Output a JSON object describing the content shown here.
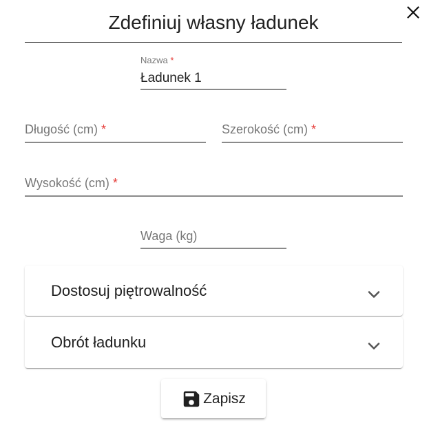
{
  "dialog": {
    "title": "Zdefiniuj własny ładunek",
    "close_icon": "close-icon"
  },
  "form": {
    "name": {
      "label": "Nazwa",
      "required_mark": "*",
      "value": "Ładunek 1"
    },
    "length": {
      "label": "Długość (cm)",
      "required_mark": "*",
      "value": ""
    },
    "width": {
      "label": "Szerokość (cm)",
      "required_mark": "*",
      "value": ""
    },
    "height": {
      "label": "Wysokość (cm)",
      "required_mark": "*",
      "value": ""
    },
    "weight": {
      "label": "Waga (kg)",
      "value": ""
    }
  },
  "panels": [
    {
      "title": "Dostosuj piętrowalność",
      "icon": "chevron-down-icon",
      "expanded": false
    },
    {
      "title": "Obrót ładunku",
      "icon": "chevron-down-icon",
      "expanded": false
    }
  ],
  "actions": {
    "save_label": "Zapisz",
    "save_icon": "floppy-disk-icon"
  },
  "colors": {
    "required": "#e53935",
    "text": "#212121",
    "label": "#8a8a8a"
  }
}
